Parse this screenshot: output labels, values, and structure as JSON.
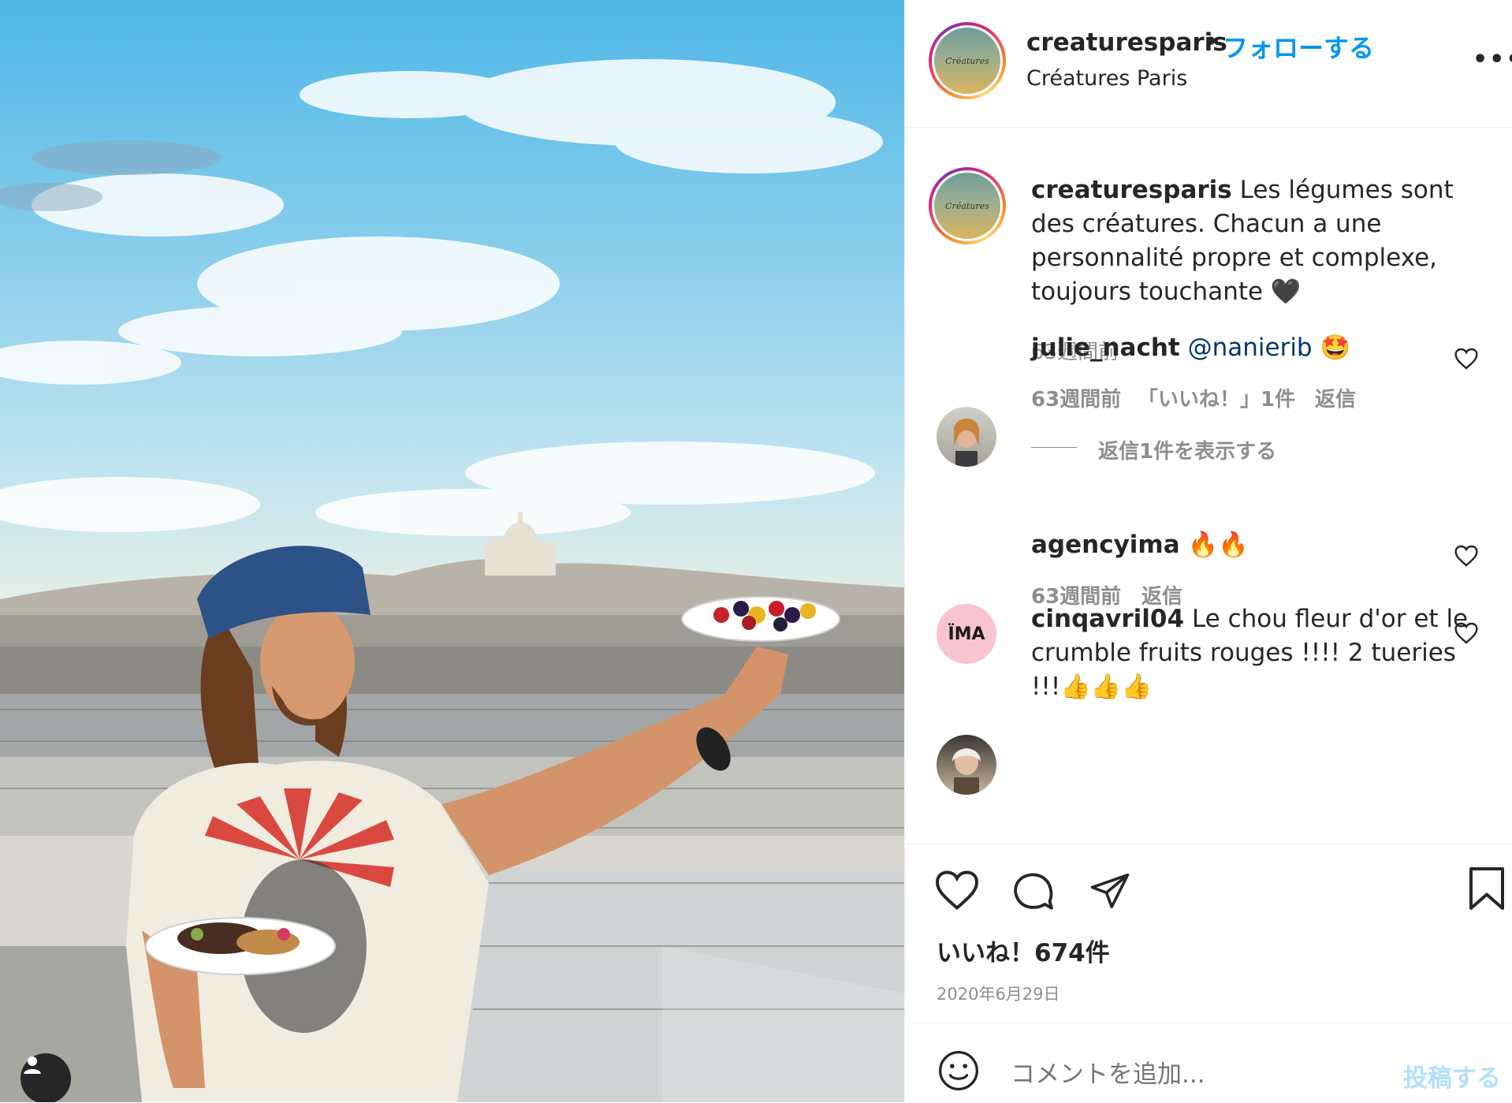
{
  "header": {
    "username": "creaturesparis",
    "separator": "•",
    "follow_label": "フォローする",
    "display_name": "Créatures Paris",
    "more_label": "•••",
    "logo_text": "Créatures"
  },
  "caption": {
    "username": "creaturesparis",
    "text": "Les légumes sont des créatures. Chacun a une personnalité propre et complexe, toujours touchante 🖤",
    "time": "63週間前"
  },
  "comments": [
    {
      "username": "julie_nacht",
      "mention": "@nanierib",
      "text": "🤩",
      "time": "63週間前",
      "likes": "「いいね！」1件",
      "reply": "返信"
    },
    {
      "username": "agencyima",
      "text": "🔥🔥",
      "time": "63週間前",
      "reply": "返信",
      "avatar_text": "ÏMA"
    },
    {
      "username": "cinqavril04",
      "text": "Le chou fleur d'or et le crumble fruits rouges !!!! 2 tueries !!!👍👍👍"
    }
  ],
  "view_replies": "返信1件を表示する",
  "likes_count": "いいね！674件",
  "post_date": "2020年6月29日",
  "compose": {
    "placeholder": "コメントを追加...",
    "post_label": "投稿する"
  },
  "colors": {
    "follow_blue": "#0095f6",
    "post_disabled": "#b2dffc",
    "muted_gray": "#8e8e8e"
  }
}
